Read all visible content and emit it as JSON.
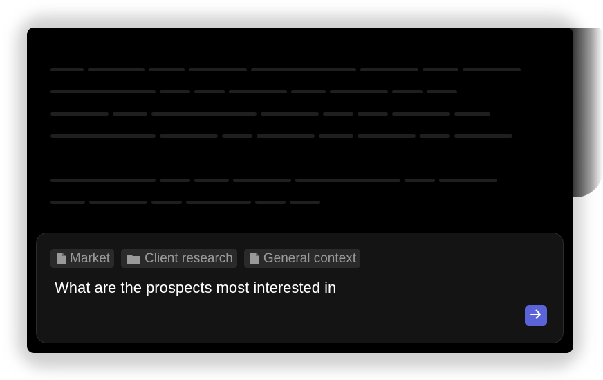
{
  "placeholder_lines": {
    "rows": [
      [
        48,
        82,
        52,
        84,
        152,
        84,
        52,
        84
      ],
      [
        152,
        44,
        44,
        84,
        50,
        84,
        44,
        44
      ],
      [
        84,
        50,
        152,
        84,
        44,
        44,
        84,
        52
      ],
      [
        152,
        84,
        44,
        84,
        50,
        84,
        44,
        84
      ],
      [
        152,
        44,
        50,
        84,
        152,
        44,
        84
      ],
      [
        50,
        84,
        44,
        94,
        44,
        44
      ]
    ]
  },
  "composer": {
    "chips": [
      {
        "label": "Market",
        "icon": "document-icon"
      },
      {
        "label": "Client research",
        "icon": "folder-icon"
      },
      {
        "label": "General context",
        "icon": "document-icon"
      }
    ],
    "input_text": "What are the prospects most interested in",
    "send_icon": "arrow-right-icon",
    "accent_color": "#5a63d8"
  }
}
